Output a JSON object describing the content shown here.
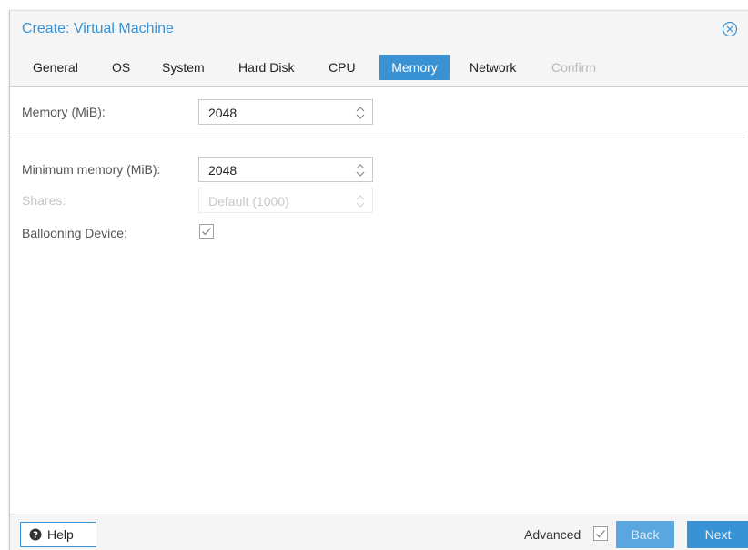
{
  "dialog": {
    "title": "Create: Virtual Machine"
  },
  "tabs": [
    {
      "label": "General",
      "state": "normal"
    },
    {
      "label": "OS",
      "state": "normal"
    },
    {
      "label": "System",
      "state": "normal"
    },
    {
      "label": "Hard Disk",
      "state": "normal"
    },
    {
      "label": "CPU",
      "state": "normal"
    },
    {
      "label": "Memory",
      "state": "active"
    },
    {
      "label": "Network",
      "state": "normal"
    },
    {
      "label": "Confirm",
      "state": "disabled"
    }
  ],
  "form": {
    "memory": {
      "label": "Memory (MiB):",
      "value": "2048"
    },
    "min_memory": {
      "label": "Minimum memory (MiB):",
      "value": "2048"
    },
    "shares": {
      "label": "Shares:",
      "value": "Default (1000)"
    },
    "ballooning": {
      "label": "Ballooning Device:",
      "checked": true
    }
  },
  "footer": {
    "help_label": "Help",
    "advanced_label": "Advanced",
    "advanced_checked": true,
    "back_label": "Back",
    "next_label": "Next"
  },
  "icons": {
    "close": "close-circle-icon",
    "help": "question-circle-icon",
    "spinner": "up-down-chevron-icon",
    "checkbox": "checkmark-icon"
  },
  "colors": {
    "accent": "#3892d4",
    "background": "#f5f5f5",
    "content_bg": "#ffffff",
    "disabled_text": "#c4c4c4"
  }
}
